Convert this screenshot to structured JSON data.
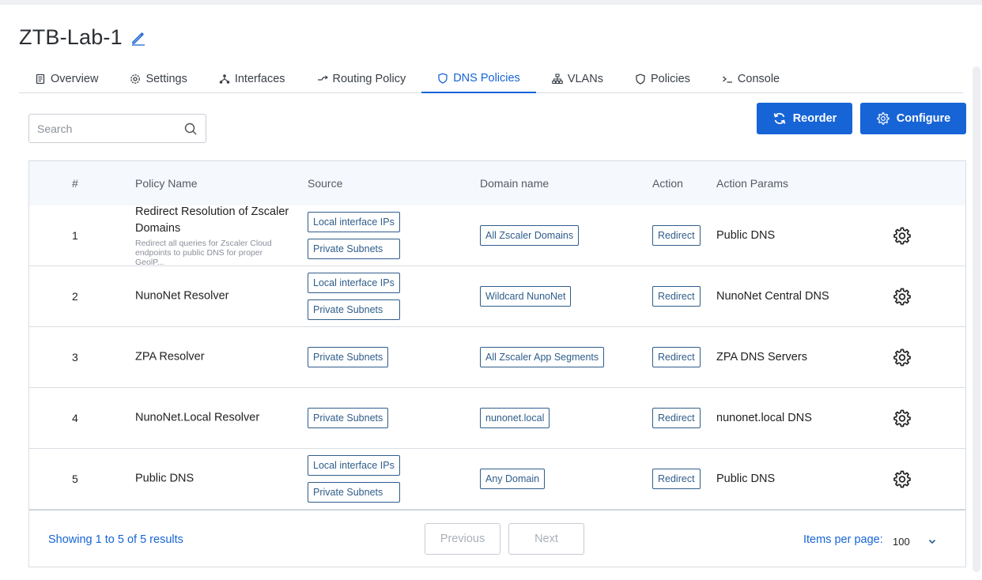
{
  "page": {
    "title": "ZTB-Lab-1"
  },
  "tabs": [
    {
      "label": "Overview",
      "icon": "document-icon"
    },
    {
      "label": "Settings",
      "icon": "gear-icon"
    },
    {
      "label": "Interfaces",
      "icon": "network-icon"
    },
    {
      "label": "Routing Policy",
      "icon": "route-icon"
    },
    {
      "label": "DNS Policies",
      "icon": "shield-icon",
      "active": true
    },
    {
      "label": "VLANs",
      "icon": "sitemap-icon"
    },
    {
      "label": "Policies",
      "icon": "shield-icon"
    },
    {
      "label": "Console",
      "icon": "terminal-icon"
    }
  ],
  "search": {
    "placeholder": "Search"
  },
  "toolbar": {
    "reorder_label": "Reorder",
    "configure_label": "Configure"
  },
  "table": {
    "columns": {
      "num": "#",
      "policy_name": "Policy Name",
      "source": "Source",
      "domain": "Domain name",
      "action": "Action",
      "params": "Action Params"
    },
    "rows": [
      {
        "num": "1",
        "name": "Redirect Resolution of Zscaler Domains",
        "desc": "Redirect all queries for Zscaler Cloud endpoints to public DNS for proper GeolP...",
        "sources": [
          "Local interface IPs",
          "Private Subnets"
        ],
        "domain": "All Zscaler Domains",
        "action": "Redirect",
        "params": "Public DNS"
      },
      {
        "num": "2",
        "name": "NunoNet Resolver",
        "desc": "",
        "sources": [
          "Local interface IPs",
          "Private Subnets"
        ],
        "domain": "Wildcard NunoNet",
        "action": "Redirect",
        "params": "NunoNet Central DNS"
      },
      {
        "num": "3",
        "name": "ZPA Resolver",
        "desc": "",
        "sources": [
          "Private Subnets"
        ],
        "domain": "All Zscaler App Segments",
        "action": "Redirect",
        "params": "ZPA DNS Servers"
      },
      {
        "num": "4",
        "name": "NunoNet.Local Resolver",
        "desc": "",
        "sources": [
          "Private Subnets"
        ],
        "domain": "nunonet.local",
        "action": "Redirect",
        "params": "nunonet.local DNS"
      },
      {
        "num": "5",
        "name": "Public DNS",
        "desc": "",
        "sources": [
          "Local interface IPs",
          "Private Subnets"
        ],
        "domain": "Any Domain",
        "action": "Redirect",
        "params": "Public DNS"
      }
    ]
  },
  "footer": {
    "showing": "Showing 1 to 5 of 5 results",
    "previous": "Previous",
    "next": "Next",
    "items_per_page_label": "Items per page:",
    "items_per_page_value": "100"
  },
  "colors": {
    "accent": "#1764d6",
    "tag_border": "#2f5d8a"
  }
}
